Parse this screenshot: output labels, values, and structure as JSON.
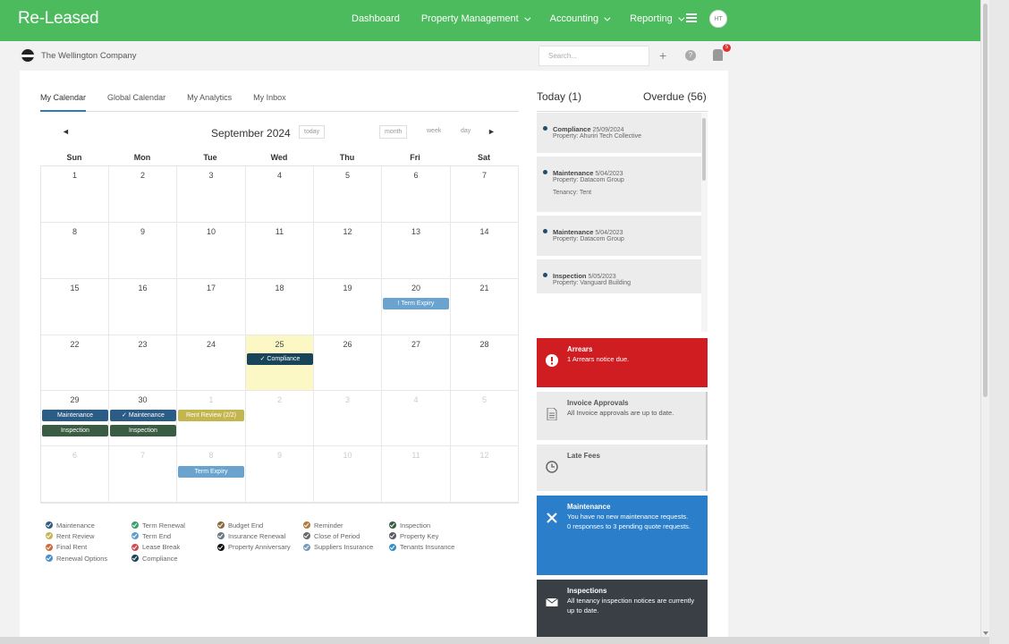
{
  "nav": {
    "brand": "Re-Leased",
    "items": [
      "Dashboard",
      "Property Management",
      "Accounting",
      "Reporting"
    ],
    "avatar": "HT"
  },
  "subheader": {
    "company": "The Wellington Company",
    "search_placeholder": "Search...",
    "notif_count": "5"
  },
  "tabs": [
    "My Calendar",
    "Global Calendar",
    "My Analytics",
    "My Inbox"
  ],
  "calendar": {
    "title": "September 2024",
    "prev": "◄",
    "next": "►",
    "today": "today",
    "views": [
      "month",
      "week",
      "day"
    ],
    "dow": [
      "Sun",
      "Mon",
      "Tue",
      "Wed",
      "Thu",
      "Fri",
      "Sat"
    ],
    "weeks": [
      [
        "1",
        "2",
        "3",
        "4",
        "5",
        "6",
        "7"
      ],
      [
        "8",
        "9",
        "10",
        "11",
        "12",
        "13",
        "14"
      ],
      [
        "15",
        "16",
        "17",
        "18",
        "19",
        "20",
        "21"
      ],
      [
        "22",
        "23",
        "24",
        "25",
        "26",
        "27",
        "28"
      ],
      [
        "29",
        "30",
        "1",
        "2",
        "3",
        "4",
        "5"
      ],
      [
        "6",
        "7",
        "8",
        "9",
        "10",
        "11",
        "12"
      ]
    ],
    "events": {
      "term_expiry_20": "! Term Expiry",
      "compliance_25": "✓ Compliance",
      "maint_29": "Maintenance",
      "insp_29": "Inspection",
      "maint_30": "✓ Maintenance",
      "insp_30": "Inspection",
      "rent_review_1": "Rent Review (2/2)",
      "term_expiry_8": "Term Expiry"
    }
  },
  "legend": [
    [
      {
        "label": "Maintenance",
        "color": "#2b5c85"
      },
      {
        "label": "Rent Review",
        "color": "#c4b64f"
      },
      {
        "label": "Final Rent",
        "color": "#d06a3a"
      },
      {
        "label": "Renewal Options",
        "color": "#4a8fc9"
      }
    ],
    [
      {
        "label": "Term Renewal",
        "color": "#3aa06a"
      },
      {
        "label": "Term End",
        "color": "#5f9ccf"
      },
      {
        "label": "Lease Break",
        "color": "#cf4d4d"
      },
      {
        "label": "Compliance",
        "color": "#18455a"
      }
    ],
    [
      {
        "label": "Budget End",
        "color": "#8a6a3a"
      },
      {
        "label": "Insurance Renewal",
        "color": "#6a7a8a"
      },
      {
        "label": "Property Anniversary",
        "color": "#111111"
      }
    ],
    [
      {
        "label": "Reminder",
        "color": "#b07a3a"
      },
      {
        "label": "Close of Period",
        "color": "#6a6a6a"
      },
      {
        "label": "Suppliers Insurance",
        "color": "#7a9aba"
      }
    ],
    [
      {
        "label": "Inspection",
        "color": "#3a5c43"
      },
      {
        "label": "Property Key",
        "color": "#5a5a6a"
      },
      {
        "label": "Tenants Insurance",
        "color": "#3a8ec9"
      }
    ]
  ],
  "right": {
    "today": "Today (1)",
    "overdue": "Overdue (56)",
    "tasks": [
      {
        "type": "Compliance",
        "date": "25/09/2024",
        "line1": "Property: Ahuriri Tech Collective",
        "line2": ""
      },
      {
        "type": "Maintenance",
        "date": "5/04/2023",
        "line1": "Property: Datacom Group",
        "line2": "Tenancy: Tent"
      },
      {
        "type": "Maintenance",
        "date": "5/04/2023",
        "line1": "Property: Datacom Group",
        "line2": ""
      },
      {
        "type": "Inspection",
        "date": "5/05/2023",
        "line1": "Property: Vanguard Building",
        "line2": ""
      }
    ],
    "cards": {
      "arrears": {
        "title": "Arrears",
        "text": "1 Arrears notice due."
      },
      "invoice": {
        "title": "Invoice Approvals",
        "text": "All Invoice approvals are up to date."
      },
      "late": {
        "title": "Late Fees",
        "text": ""
      },
      "maint": {
        "title": "Maintenance",
        "text1": "You have no new maintenance requests.",
        "text2": "0 responses to 3 pending quote requests."
      },
      "insp": {
        "title": "Inspections",
        "text": "All tenancy inspection notices are currently up to date."
      }
    }
  }
}
